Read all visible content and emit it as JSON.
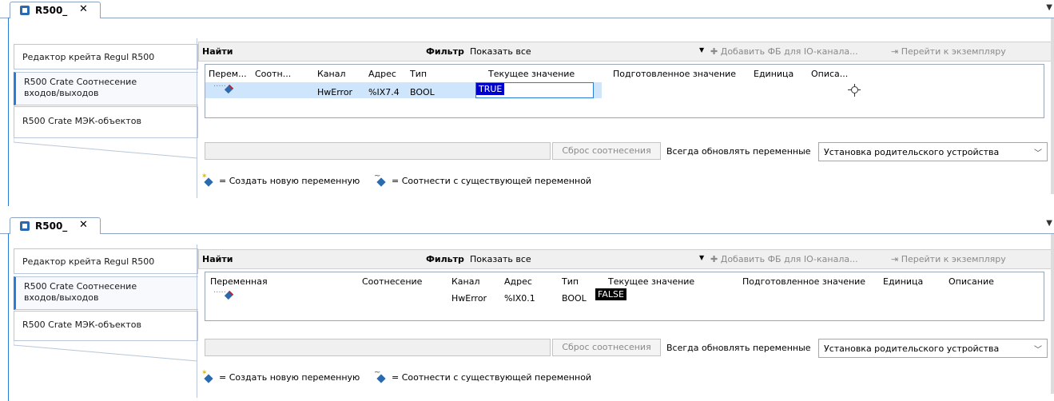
{
  "panels": [
    {
      "tab": {
        "title": "R500_",
        "close": "✕"
      },
      "sidebar": [
        {
          "label": "Редактор крейта Regul R500"
        },
        {
          "label": "R500 Crate Соотнесение входов/выходов"
        },
        {
          "label": "R500 Crate МЭК-объектов"
        }
      ],
      "toolbar": {
        "find": "Найти",
        "filter_label": "Фильтр",
        "filter_value": "Показать все",
        "add_fb": "Добавить ФБ для IO-канала...",
        "goto": "Перейти к экземпляру"
      },
      "columns": [
        "Перем...",
        "Соотн...",
        "Канал",
        "Адрес",
        "Тип",
        "Текущее значение",
        "Подготовленное значение",
        "Единица",
        "Описа..."
      ],
      "row": {
        "channel": "HwError",
        "address": "%IX7.4",
        "type": "BOOL",
        "current": "TRUE"
      },
      "reset": "Сброс соотнесения",
      "always_update": "Всегда обновлять переменные",
      "select_value": "Установка родительского устройства",
      "legend_new": "= Создать новую переменную",
      "legend_map": "= Соотнести с существующей переменной"
    },
    {
      "tab": {
        "title": "R500_",
        "close": "✕"
      },
      "sidebar": [
        {
          "label": "Редактор крейта Regul R500"
        },
        {
          "label": "R500 Crate Соотнесение входов/выходов"
        },
        {
          "label": "R500 Crate МЭК-объектов"
        }
      ],
      "toolbar": {
        "find": "Найти",
        "filter_label": "Фильтр",
        "filter_value": "Показать все",
        "add_fb": "Добавить ФБ для IO-канала...",
        "goto": "Перейти к экземпляру"
      },
      "columns": [
        "Переменная",
        "Соотнесение",
        "Канал",
        "Адрес",
        "Тип",
        "Текущее значение",
        "Подготовленное значение",
        "Единица",
        "Описание"
      ],
      "row": {
        "channel": "HwError",
        "address": "%IX0.1",
        "type": "BOOL",
        "current": "FALSE"
      },
      "reset": "Сброс соотнесения",
      "always_update": "Всегда обновлять переменные",
      "select_value": "Установка родительского устройства",
      "legend_new": "= Создать новую переменную",
      "legend_map": "= Соотнести с существующей переменной"
    }
  ],
  "colors": {
    "true_bg": "#0000cc",
    "false_bg": "#000000",
    "accent": "#2a7bd8"
  }
}
